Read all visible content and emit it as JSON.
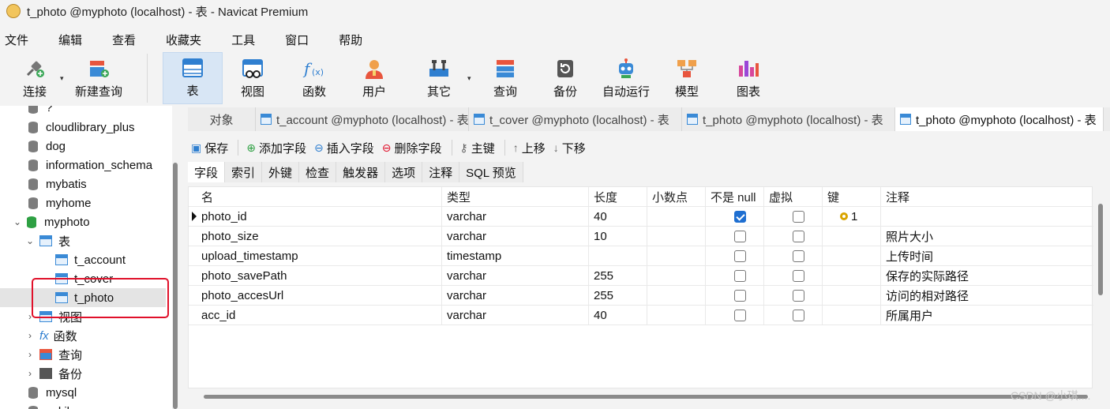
{
  "window": {
    "title": "t_photo @myphoto (localhost) - 表 - Navicat Premium"
  },
  "menu": [
    "文件",
    "编辑",
    "查看",
    "收藏夹",
    "工具",
    "窗口",
    "帮助"
  ],
  "toolbar": {
    "connect": "连接",
    "new_query": "新建查询",
    "table": "表",
    "view": "视图",
    "function": "函数",
    "user": "用户",
    "other": "其它",
    "query": "查询",
    "backup": "备份",
    "automation": "自动运行",
    "model": "模型",
    "chart": "图表"
  },
  "sidebar": {
    "top_partial": "?",
    "databases": [
      "cloudlibrary_plus",
      "dog",
      "information_schema",
      "mybatis",
      "myhome"
    ],
    "current_db": "myphoto",
    "tables_group": "表",
    "tables": [
      "t_account",
      "t_cover",
      "t_photo"
    ],
    "selected_table": "t_photo",
    "groups": [
      "视图",
      "函数",
      "查询",
      "备份"
    ],
    "after": [
      "mysql",
      "sakila"
    ]
  },
  "tabs": {
    "objects": "对象",
    "items": [
      "t_account @myphoto (localhost) - 表",
      "t_cover @myphoto (localhost) - 表",
      "t_photo @myphoto (localhost) - 表",
      "t_photo @myphoto (localhost) - 表"
    ]
  },
  "editor_toolbar": {
    "save": "保存",
    "add_field": "添加字段",
    "insert_field": "插入字段",
    "delete_field": "删除字段",
    "primary_key": "主键",
    "move_up": "上移",
    "move_down": "下移"
  },
  "subtabs": [
    "字段",
    "索引",
    "外键",
    "检查",
    "触发器",
    "选项",
    "注释",
    "SQL 预览"
  ],
  "grid": {
    "headers": [
      "名",
      "类型",
      "长度",
      "小数点",
      "不是 null",
      "虚拟",
      "键",
      "注释"
    ],
    "rows": [
      {
        "name": "photo_id",
        "type": "varchar",
        "length": "40",
        "decimal": "",
        "not_null": true,
        "virtual": false,
        "key": "1",
        "comment": ""
      },
      {
        "name": "photo_size",
        "type": "varchar",
        "length": "10",
        "decimal": "",
        "not_null": false,
        "virtual": false,
        "key": "",
        "comment": "照片大小"
      },
      {
        "name": "upload_timestamp",
        "type": "timestamp",
        "length": "",
        "decimal": "",
        "not_null": false,
        "virtual": false,
        "key": "",
        "comment": "上传时间"
      },
      {
        "name": "photo_savePath",
        "type": "varchar",
        "length": "255",
        "decimal": "",
        "not_null": false,
        "virtual": false,
        "key": "",
        "comment": "保存的实际路径"
      },
      {
        "name": "photo_accesUrl",
        "type": "varchar",
        "length": "255",
        "decimal": "",
        "not_null": false,
        "virtual": false,
        "key": "",
        "comment": "访问的相对路径"
      },
      {
        "name": "acc_id",
        "type": "varchar",
        "length": "40",
        "decimal": "",
        "not_null": false,
        "virtual": false,
        "key": "",
        "comment": "所属用户"
      }
    ]
  },
  "watermark": "CSDN @小琪...."
}
